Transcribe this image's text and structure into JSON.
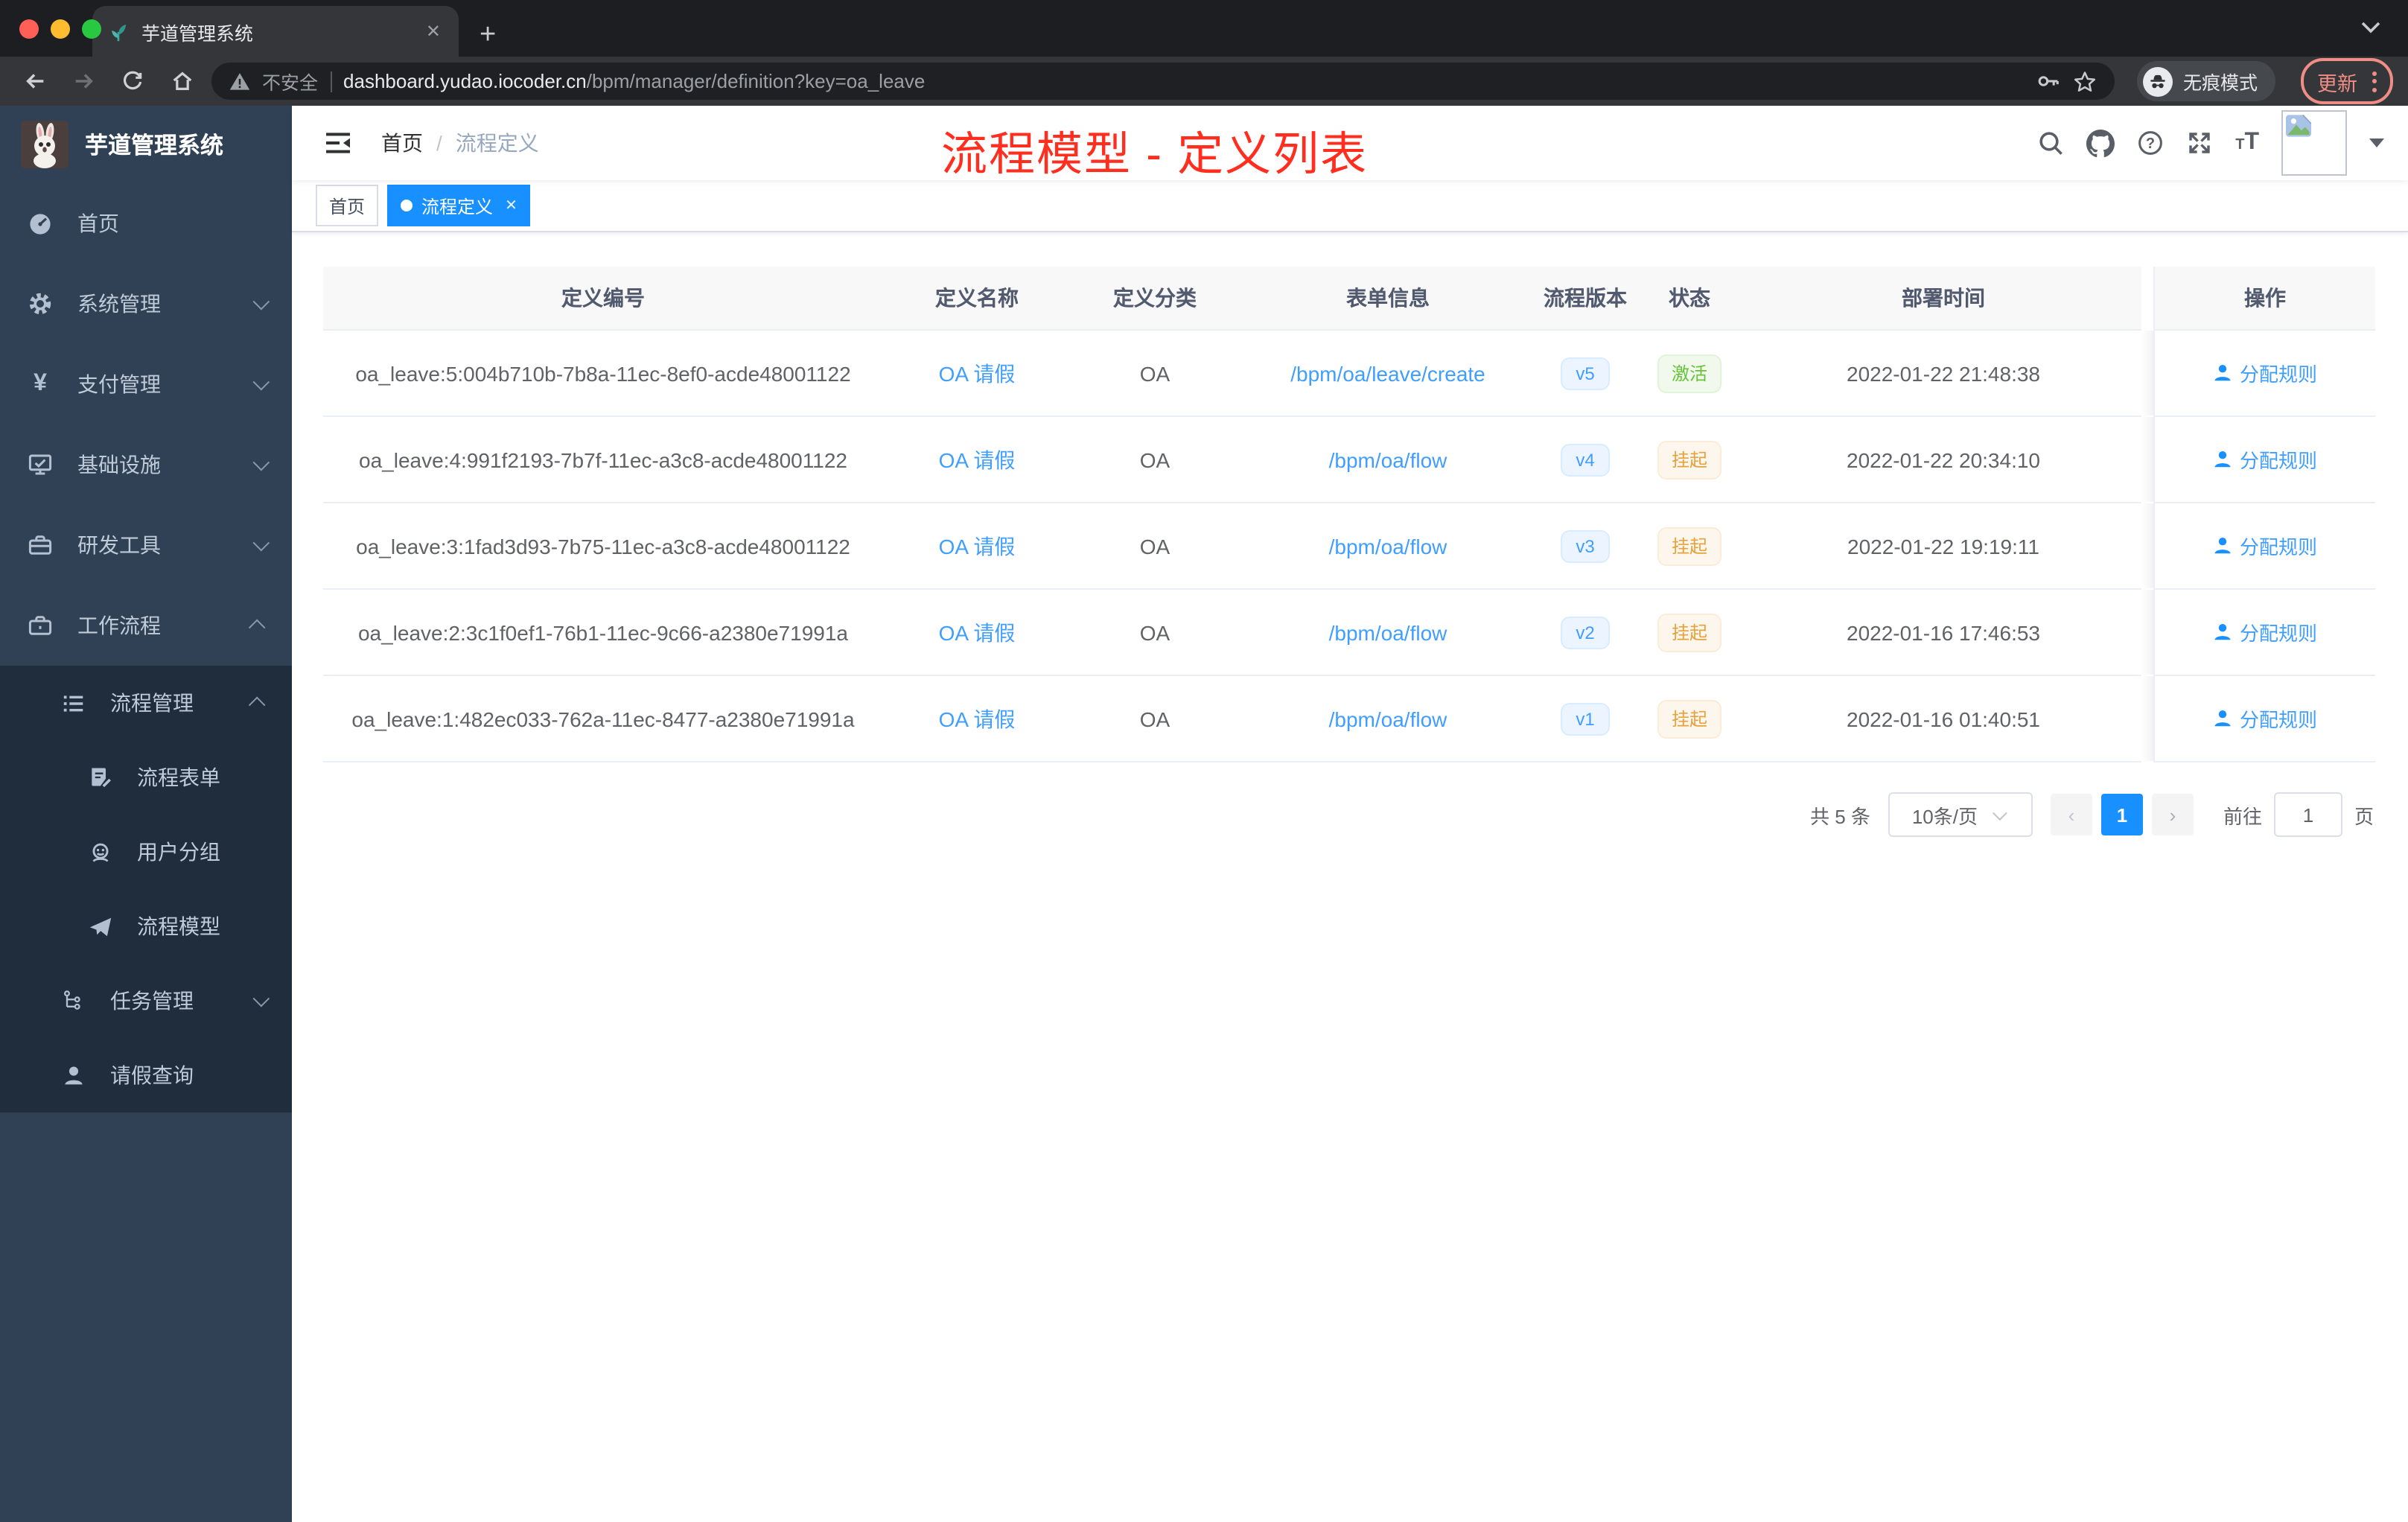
{
  "browser": {
    "tab_title": "芋道管理系统",
    "tab_close": "✕",
    "new_tab": "+",
    "security_label": "不安全",
    "url_domain": "dashboard.yudao.iocoder.cn",
    "url_path": "/bpm/manager/definition?key=oa_leave",
    "incognito_label": "无痕模式",
    "update_label": "更新"
  },
  "sidebar": {
    "logo_title": "芋道管理系统",
    "menu": [
      {
        "label": "首页"
      },
      {
        "label": "系统管理"
      },
      {
        "label": "支付管理"
      },
      {
        "label": "基础设施"
      },
      {
        "label": "研发工具"
      },
      {
        "label": "工作流程"
      }
    ],
    "submenu": [
      {
        "label": "流程管理"
      },
      {
        "label": "流程表单"
      },
      {
        "label": "用户分组"
      },
      {
        "label": "流程模型"
      },
      {
        "label": "任务管理"
      },
      {
        "label": "请假查询"
      }
    ]
  },
  "navbar": {
    "breadcrumb_home": "首页",
    "breadcrumb_separator": "/",
    "breadcrumb_current": "流程定义",
    "annotation": "流程模型 - 定义列表"
  },
  "tags_view": {
    "tags": [
      {
        "label": "首页",
        "active": false
      },
      {
        "label": "流程定义",
        "active": true,
        "close": "✕"
      }
    ]
  },
  "table": {
    "columns": [
      "定义编号",
      "定义名称",
      "定义分类",
      "表单信息",
      "流程版本",
      "状态",
      "部署时间",
      "操作"
    ],
    "rows": [
      {
        "id": "oa_leave:5:004b710b-7b8a-11ec-8ef0-acde48001122",
        "name": "OA 请假",
        "category": "OA",
        "form": "/bpm/oa/leave/create",
        "version": "v5",
        "status": "激活",
        "status_type": "success",
        "deploy_time": "2022-01-22 21:48:38",
        "action": "分配规则"
      },
      {
        "id": "oa_leave:4:991f2193-7b7f-11ec-a3c8-acde48001122",
        "name": "OA 请假",
        "category": "OA",
        "form": "/bpm/oa/flow",
        "version": "v4",
        "status": "挂起",
        "status_type": "warning",
        "deploy_time": "2022-01-22 20:34:10",
        "action": "分配规则"
      },
      {
        "id": "oa_leave:3:1fad3d93-7b75-11ec-a3c8-acde48001122",
        "name": "OA 请假",
        "category": "OA",
        "form": "/bpm/oa/flow",
        "version": "v3",
        "status": "挂起",
        "status_type": "warning",
        "deploy_time": "2022-01-22 19:19:11",
        "action": "分配规则"
      },
      {
        "id": "oa_leave:2:3c1f0ef1-76b1-11ec-9c66-a2380e71991a",
        "name": "OA 请假",
        "category": "OA",
        "form": "/bpm/oa/flow",
        "version": "v2",
        "status": "挂起",
        "status_type": "warning",
        "deploy_time": "2022-01-16 17:46:53",
        "action": "分配规则"
      },
      {
        "id": "oa_leave:1:482ec033-762a-11ec-8477-a2380e71991a",
        "name": "OA 请假",
        "category": "OA",
        "form": "/bpm/oa/flow",
        "version": "v1",
        "status": "挂起",
        "status_type": "warning",
        "deploy_time": "2022-01-16 01:40:51",
        "action": "分配规则"
      }
    ]
  },
  "pagination": {
    "total": "共 5 条",
    "page_size": "10条/页",
    "prev": "‹",
    "current_page": "1",
    "next": "›",
    "goto_label": "前往",
    "goto_value": "1",
    "page_unit": "页"
  },
  "icons": {
    "favicon-icon": "green seedling",
    "dashboard-icon": "speedometer",
    "gear-icon": "gear",
    "yen-icon": "¥",
    "monitor-icon": "monitor with check",
    "toolbox-icon": "briefcase",
    "workflow-icon": "briefcase",
    "process-list-icon": "list",
    "form-icon": "document with pen",
    "user-group-icon": "face",
    "send-icon": "paper plane",
    "task-tree-icon": "tree",
    "person-icon": "person silhouette",
    "incognito-icon": "hat and glasses",
    "broken-image-icon": "photo placeholder"
  },
  "colors": {
    "accent": "#1890ff",
    "link": "#409eff",
    "success": "#67c23a",
    "warning": "#e6a23c",
    "sidebar_bg": "#304156",
    "submenu_bg": "#1f2d3d",
    "annotation_red": "#ff2e1f",
    "update_button": "#f08e85"
  }
}
